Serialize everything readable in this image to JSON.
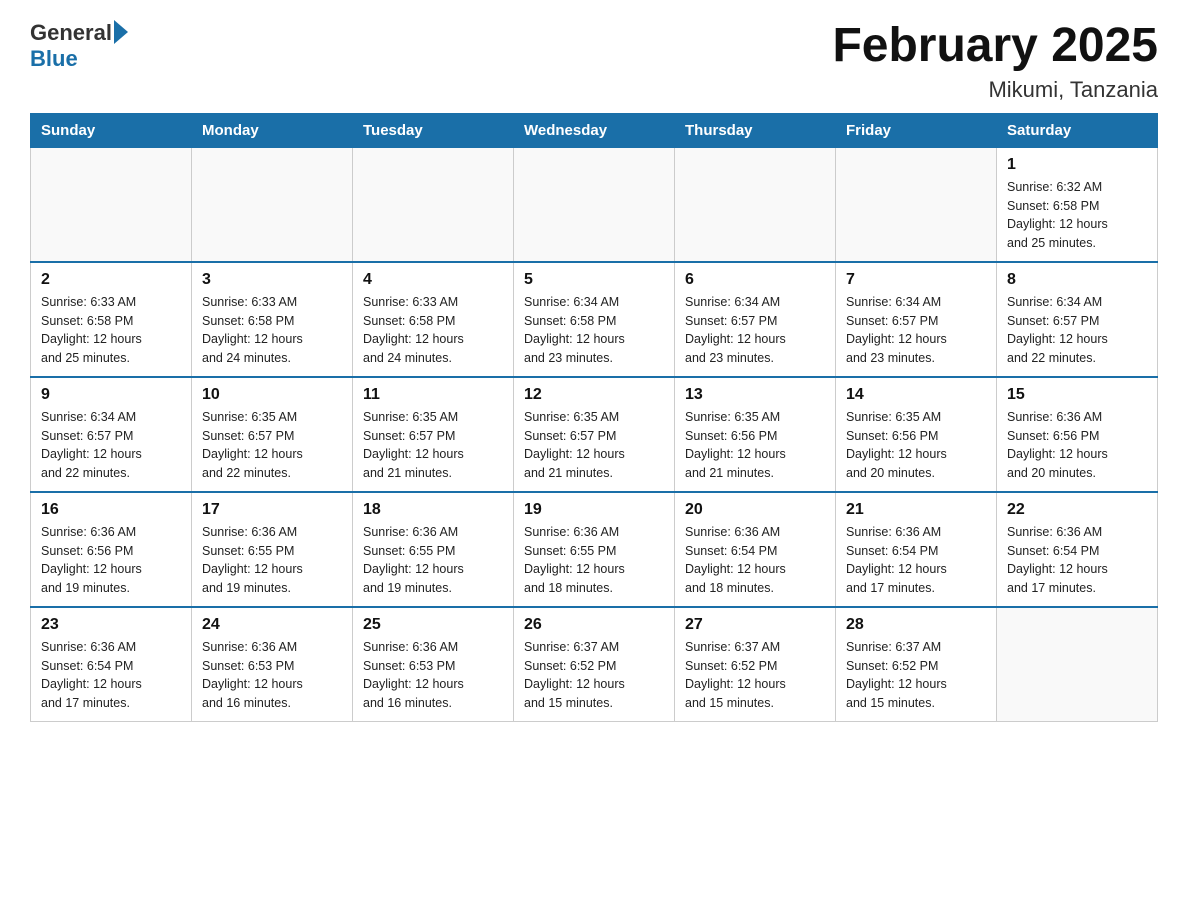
{
  "header": {
    "logo_general": "General",
    "logo_blue": "Blue",
    "month_title": "February 2025",
    "location": "Mikumi, Tanzania"
  },
  "weekdays": [
    "Sunday",
    "Monday",
    "Tuesday",
    "Wednesday",
    "Thursday",
    "Friday",
    "Saturday"
  ],
  "weeks": [
    [
      {
        "day": "",
        "info": ""
      },
      {
        "day": "",
        "info": ""
      },
      {
        "day": "",
        "info": ""
      },
      {
        "day": "",
        "info": ""
      },
      {
        "day": "",
        "info": ""
      },
      {
        "day": "",
        "info": ""
      },
      {
        "day": "1",
        "info": "Sunrise: 6:32 AM\nSunset: 6:58 PM\nDaylight: 12 hours\nand 25 minutes."
      }
    ],
    [
      {
        "day": "2",
        "info": "Sunrise: 6:33 AM\nSunset: 6:58 PM\nDaylight: 12 hours\nand 25 minutes."
      },
      {
        "day": "3",
        "info": "Sunrise: 6:33 AM\nSunset: 6:58 PM\nDaylight: 12 hours\nand 24 minutes."
      },
      {
        "day": "4",
        "info": "Sunrise: 6:33 AM\nSunset: 6:58 PM\nDaylight: 12 hours\nand 24 minutes."
      },
      {
        "day": "5",
        "info": "Sunrise: 6:34 AM\nSunset: 6:58 PM\nDaylight: 12 hours\nand 23 minutes."
      },
      {
        "day": "6",
        "info": "Sunrise: 6:34 AM\nSunset: 6:57 PM\nDaylight: 12 hours\nand 23 minutes."
      },
      {
        "day": "7",
        "info": "Sunrise: 6:34 AM\nSunset: 6:57 PM\nDaylight: 12 hours\nand 23 minutes."
      },
      {
        "day": "8",
        "info": "Sunrise: 6:34 AM\nSunset: 6:57 PM\nDaylight: 12 hours\nand 22 minutes."
      }
    ],
    [
      {
        "day": "9",
        "info": "Sunrise: 6:34 AM\nSunset: 6:57 PM\nDaylight: 12 hours\nand 22 minutes."
      },
      {
        "day": "10",
        "info": "Sunrise: 6:35 AM\nSunset: 6:57 PM\nDaylight: 12 hours\nand 22 minutes."
      },
      {
        "day": "11",
        "info": "Sunrise: 6:35 AM\nSunset: 6:57 PM\nDaylight: 12 hours\nand 21 minutes."
      },
      {
        "day": "12",
        "info": "Sunrise: 6:35 AM\nSunset: 6:57 PM\nDaylight: 12 hours\nand 21 minutes."
      },
      {
        "day": "13",
        "info": "Sunrise: 6:35 AM\nSunset: 6:56 PM\nDaylight: 12 hours\nand 21 minutes."
      },
      {
        "day": "14",
        "info": "Sunrise: 6:35 AM\nSunset: 6:56 PM\nDaylight: 12 hours\nand 20 minutes."
      },
      {
        "day": "15",
        "info": "Sunrise: 6:36 AM\nSunset: 6:56 PM\nDaylight: 12 hours\nand 20 minutes."
      }
    ],
    [
      {
        "day": "16",
        "info": "Sunrise: 6:36 AM\nSunset: 6:56 PM\nDaylight: 12 hours\nand 19 minutes."
      },
      {
        "day": "17",
        "info": "Sunrise: 6:36 AM\nSunset: 6:55 PM\nDaylight: 12 hours\nand 19 minutes."
      },
      {
        "day": "18",
        "info": "Sunrise: 6:36 AM\nSunset: 6:55 PM\nDaylight: 12 hours\nand 19 minutes."
      },
      {
        "day": "19",
        "info": "Sunrise: 6:36 AM\nSunset: 6:55 PM\nDaylight: 12 hours\nand 18 minutes."
      },
      {
        "day": "20",
        "info": "Sunrise: 6:36 AM\nSunset: 6:54 PM\nDaylight: 12 hours\nand 18 minutes."
      },
      {
        "day": "21",
        "info": "Sunrise: 6:36 AM\nSunset: 6:54 PM\nDaylight: 12 hours\nand 17 minutes."
      },
      {
        "day": "22",
        "info": "Sunrise: 6:36 AM\nSunset: 6:54 PM\nDaylight: 12 hours\nand 17 minutes."
      }
    ],
    [
      {
        "day": "23",
        "info": "Sunrise: 6:36 AM\nSunset: 6:54 PM\nDaylight: 12 hours\nand 17 minutes."
      },
      {
        "day": "24",
        "info": "Sunrise: 6:36 AM\nSunset: 6:53 PM\nDaylight: 12 hours\nand 16 minutes."
      },
      {
        "day": "25",
        "info": "Sunrise: 6:36 AM\nSunset: 6:53 PM\nDaylight: 12 hours\nand 16 minutes."
      },
      {
        "day": "26",
        "info": "Sunrise: 6:37 AM\nSunset: 6:52 PM\nDaylight: 12 hours\nand 15 minutes."
      },
      {
        "day": "27",
        "info": "Sunrise: 6:37 AM\nSunset: 6:52 PM\nDaylight: 12 hours\nand 15 minutes."
      },
      {
        "day": "28",
        "info": "Sunrise: 6:37 AM\nSunset: 6:52 PM\nDaylight: 12 hours\nand 15 minutes."
      },
      {
        "day": "",
        "info": ""
      }
    ]
  ]
}
